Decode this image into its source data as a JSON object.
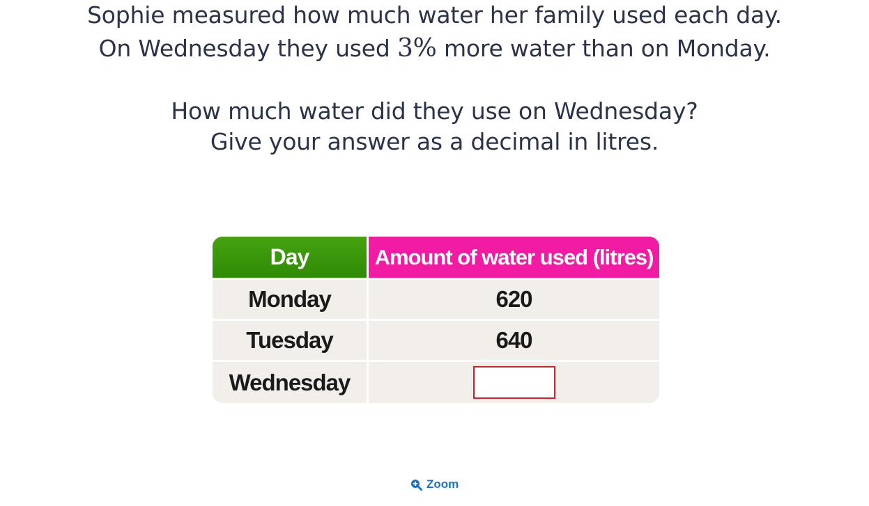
{
  "question": {
    "line1": "Sophie measured how much water her family used each day.",
    "line2_prefix": "On Wednesday they used ",
    "line2_math": "3%",
    "line2_suffix": " more water than on Monday.",
    "line3": "How much water did they use on Wednesday?",
    "line4": "Give your answer as a decimal in litres."
  },
  "table": {
    "headers": [
      "Day",
      "Amount of water used (litres)"
    ],
    "rows": [
      {
        "day": "Monday",
        "amount": "620"
      },
      {
        "day": "Tuesday",
        "amount": "640"
      },
      {
        "day": "Wednesday",
        "amount": ""
      }
    ],
    "header_colors": {
      "day": "#3c9a0b",
      "amount": "#f11ba4"
    },
    "answer_box_border": "#d6202a"
  },
  "zoom": {
    "label": "Zoom",
    "icon": "zoom-in-icon"
  }
}
